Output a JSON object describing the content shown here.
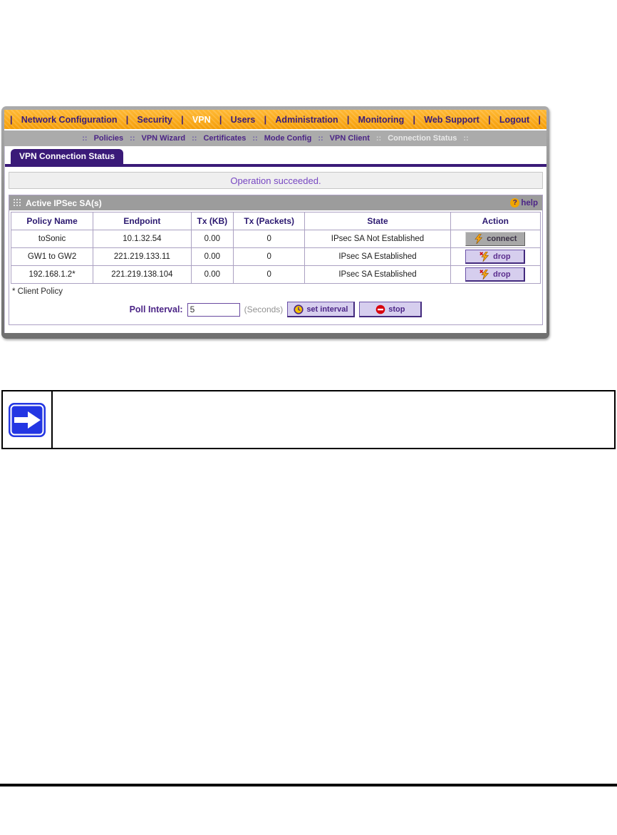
{
  "screenshot": {
    "navbar": {
      "separator": "|",
      "bg": "#F5A00B",
      "text_color": "#3B1E78",
      "active_text_color": "#FFFFFF",
      "items": [
        {
          "label": "Network Configuration",
          "active": false
        },
        {
          "label": "Security",
          "active": false
        },
        {
          "label": "VPN",
          "active": true
        },
        {
          "label": "Users",
          "active": false
        },
        {
          "label": "Administration",
          "active": false
        },
        {
          "label": "Monitoring",
          "active": false
        },
        {
          "label": "Web Support",
          "active": false
        },
        {
          "label": "Logout",
          "active": false
        }
      ]
    },
    "submenu": {
      "separator": "::",
      "bg": "#ABABAB",
      "text_color": "#4B2486",
      "active_text_color": "#E9E9E9",
      "items": [
        {
          "label": "Policies",
          "active": false
        },
        {
          "label": "VPN Wizard",
          "active": false
        },
        {
          "label": "Certificates",
          "active": false
        },
        {
          "label": "Mode Config",
          "active": false
        },
        {
          "label": "VPN Client",
          "active": false
        },
        {
          "label": "Connection Status",
          "active": true
        }
      ]
    },
    "tab": {
      "label": "VPN Connection Status",
      "bg": "#3A1A78"
    },
    "status_message": "Operation succeeded.",
    "section": {
      "title": "Active IPSec SA(s)",
      "grid_icon": "grid-dots-icon",
      "help_icon": "?",
      "help_label": "help",
      "help_icon_color": "#F0A500",
      "table": {
        "columns": [
          "Policy Name",
          "Endpoint",
          "Tx (KB)",
          "Tx (Packets)",
          "State",
          "Action"
        ],
        "rows": [
          {
            "policy_name": "toSonic",
            "endpoint": "10.1.32.54",
            "tx_kb": "0.00",
            "tx_packets": "0",
            "state": "IPsec SA Not Established",
            "action": "connect",
            "action_icon": "lightning-icon"
          },
          {
            "policy_name": "GW1 to GW2",
            "endpoint": "221.219.133.11",
            "tx_kb": "0.00",
            "tx_packets": "0",
            "state": "IPsec SA Established",
            "action": "drop",
            "action_icon": "lightning-x-icon"
          },
          {
            "policy_name": "192.168.1.2*",
            "endpoint": "221.219.138.104",
            "tx_kb": "0.00",
            "tx_packets": "0",
            "state": "IPsec SA Established",
            "action": "drop",
            "action_icon": "lightning-x-icon"
          }
        ]
      },
      "footnote": "* Client Policy",
      "poll": {
        "label": "Poll Interval:",
        "value": "5",
        "unit": "(Seconds)",
        "set_button": "set interval",
        "set_button_icon": "clock-icon",
        "stop_button": "stop",
        "stop_button_icon": "no-entry-icon"
      }
    }
  },
  "note": {
    "icon": "arrow-right-icon",
    "icon_color": "#2336E3",
    "text": ""
  }
}
